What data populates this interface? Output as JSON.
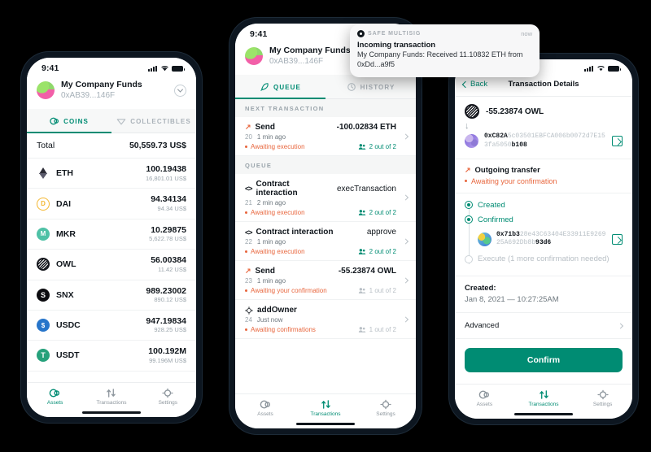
{
  "statusbar": {
    "time": "9:41"
  },
  "account": {
    "name": "My Company Funds",
    "address": "0xAB39...146F"
  },
  "phone_assets": {
    "tabs": [
      {
        "label": "COINS",
        "icon": "coins-icon",
        "active": true
      },
      {
        "label": "COLLECTIBLES",
        "icon": "diamond-icon",
        "active": false
      }
    ],
    "total_label": "Total",
    "total_value": "50,559.73 US$",
    "coins": [
      {
        "symbol": "ETH",
        "amount": "100.19438",
        "fiat": "16,801.01 US$",
        "icon": "eth-icon"
      },
      {
        "symbol": "DAI",
        "amount": "94.34134",
        "fiat": "94.34 US$",
        "icon": "dai-icon"
      },
      {
        "symbol": "MKR",
        "amount": "10.29875",
        "fiat": "5,622.78 US$",
        "icon": "mkr-icon"
      },
      {
        "symbol": "OWL",
        "amount": "56.00384",
        "fiat": "11.42 US$",
        "icon": "owl-icon"
      },
      {
        "symbol": "SNX",
        "amount": "989.23002",
        "fiat": "890.12 US$",
        "icon": "snx-icon"
      },
      {
        "symbol": "USDC",
        "amount": "947.19834",
        "fiat": "928.25 US$",
        "icon": "usdc-icon"
      },
      {
        "symbol": "USDT",
        "amount": "100.192M",
        "fiat": "99.196M US$",
        "icon": "usdt-icon"
      }
    ]
  },
  "notification": {
    "app": "SAFE MULTISIG",
    "time": "now",
    "title": "Incoming transaction",
    "body": "My Company Funds: Received 11.10832 ETH from 0xDd...a9f5"
  },
  "phone_queue": {
    "tabs": [
      {
        "label": "QUEUE",
        "icon": "rocket-icon",
        "active": true
      },
      {
        "label": "HISTORY",
        "icon": "clock-icon",
        "active": false
      }
    ],
    "sections": [
      {
        "title": "NEXT TRANSACTION",
        "rows": [
          {
            "icon": "outgoing-arrow-icon",
            "type": "Send",
            "method": "",
            "amount": "-100.02834 ETH",
            "nonce": "20",
            "time": "1 min ago",
            "status": "Awaiting execution",
            "confirmations": "2 out of 2",
            "confirmed": true
          }
        ]
      },
      {
        "title": "QUEUE",
        "rows": [
          {
            "icon": "code-icon",
            "type": "Contract interaction",
            "method": "execTransaction",
            "amount": "",
            "nonce": "21",
            "time": "2 min ago",
            "status": "Awaiting execution",
            "confirmations": "2 out of 2",
            "confirmed": true
          },
          {
            "icon": "code-icon",
            "type": "Contract interaction",
            "method": "approve",
            "amount": "",
            "nonce": "22",
            "time": "1 min ago",
            "status": "Awaiting execution",
            "confirmations": "2 out of 2",
            "confirmed": true
          },
          {
            "icon": "outgoing-arrow-icon",
            "type": "Send",
            "method": "",
            "amount": "-55.23874 OWL",
            "nonce": "23",
            "time": "1 min ago",
            "status": "Awaiting your confirmation",
            "confirmations": "1 out of 2",
            "confirmed": false
          },
          {
            "icon": "settings-gear-icon",
            "type": "addOwner",
            "method": "",
            "amount": "",
            "nonce": "24",
            "time": "Just now",
            "status": "Awaiting confirmations",
            "confirmations": "1 out of 2",
            "confirmed": false
          }
        ]
      }
    ]
  },
  "phone_details": {
    "back_label": "Back",
    "title": "Transaction Details",
    "amount": "-55.23874 OWL",
    "amount_icon": "owl-icon",
    "recipient": {
      "prefix": "0xC82A",
      "middle": "5c03501EBFCA006b0072d7E153fa5050",
      "suffix": "b108"
    },
    "kind": "Outgoing transfer",
    "await_status": "Awaiting your confirmation",
    "steps": [
      {
        "label": "Created",
        "done": true
      },
      {
        "label": "Confirmed",
        "done": true
      },
      {
        "label": "Execute (1 more confirmation needed)",
        "done": false
      }
    ],
    "confirmer": {
      "prefix": "0x71b3",
      "middle": "28e43C63404E33911E926925A692Db8b",
      "suffix": "93d6"
    },
    "created_label": "Created:",
    "created_value": "Jan 8, 2021 — 10:27:25AM",
    "advanced_label": "Advanced",
    "confirm_label": "Confirm"
  },
  "bottomnav": {
    "items": [
      {
        "label": "Assets",
        "icon": "assets-icon"
      },
      {
        "label": "Transactions",
        "icon": "transactions-icon"
      },
      {
        "label": "Settings",
        "icon": "settings-gear-icon"
      }
    ]
  },
  "colors": {
    "accent": "#008c73",
    "warning": "#e8663d",
    "dark": "#10161c"
  }
}
